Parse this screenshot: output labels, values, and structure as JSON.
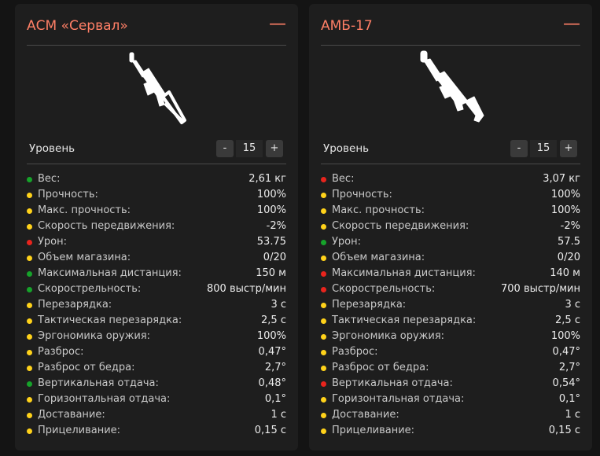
{
  "colors": {
    "green": "#16a32a",
    "yellow": "#ffd21a",
    "red": "#e8241d",
    "accent": "#ff7f66"
  },
  "cards": [
    {
      "title": "АСМ «Сервал»",
      "collapse_icon": "minus-icon",
      "image_icon": "rifle-silhouette-icon",
      "level": {
        "label": "Уровень",
        "minus": "-",
        "value": "15",
        "plus": "+"
      },
      "stats": [
        {
          "name": "Вес:",
          "value": "2,61 кг",
          "status": "green"
        },
        {
          "name": "Прочность:",
          "value": "100%",
          "status": "yellow"
        },
        {
          "name": "Макс. прочность:",
          "value": "100%",
          "status": "yellow"
        },
        {
          "name": "Скорость передвижения:",
          "value": "-2%",
          "status": "yellow"
        },
        {
          "name": "Урон:",
          "value": "53.75",
          "status": "red"
        },
        {
          "name": "Объем магазина:",
          "value": "0/20",
          "status": "yellow"
        },
        {
          "name": "Максимальная дистанция:",
          "value": "150 м",
          "status": "green"
        },
        {
          "name": "Скорострельность:",
          "value": "800 выстр/мин",
          "status": "green"
        },
        {
          "name": "Перезарядка:",
          "value": "3 с",
          "status": "yellow"
        },
        {
          "name": "Тактическая перезарядка:",
          "value": "2,5 с",
          "status": "yellow"
        },
        {
          "name": "Эргономика оружия:",
          "value": "100%",
          "status": "yellow"
        },
        {
          "name": "Разброс:",
          "value": "0,47°",
          "status": "yellow"
        },
        {
          "name": "Разброс от бедра:",
          "value": "2,7°",
          "status": "yellow"
        },
        {
          "name": "Вертикальная отдача:",
          "value": "0,48°",
          "status": "green"
        },
        {
          "name": "Горизонтальная отдача:",
          "value": "0,1°",
          "status": "yellow"
        },
        {
          "name": "Доставание:",
          "value": "1 с",
          "status": "yellow"
        },
        {
          "name": "Прицеливание:",
          "value": "0,15 с",
          "status": "yellow"
        }
      ]
    },
    {
      "title": "АМБ-17",
      "collapse_icon": "minus-icon",
      "image_icon": "smg-silhouette-icon",
      "level": {
        "label": "Уровень",
        "minus": "-",
        "value": "15",
        "plus": "+"
      },
      "stats": [
        {
          "name": "Вес:",
          "value": "3,07 кг",
          "status": "red"
        },
        {
          "name": "Прочность:",
          "value": "100%",
          "status": "yellow"
        },
        {
          "name": "Макс. прочность:",
          "value": "100%",
          "status": "yellow"
        },
        {
          "name": "Скорость передвижения:",
          "value": "-2%",
          "status": "yellow"
        },
        {
          "name": "Урон:",
          "value": "57.5",
          "status": "green"
        },
        {
          "name": "Объем магазина:",
          "value": "0/20",
          "status": "yellow"
        },
        {
          "name": "Максимальная дистанция:",
          "value": "140 м",
          "status": "red"
        },
        {
          "name": "Скорострельность:",
          "value": "700 выстр/мин",
          "status": "red"
        },
        {
          "name": "Перезарядка:",
          "value": "3 с",
          "status": "yellow"
        },
        {
          "name": "Тактическая перезарядка:",
          "value": "2,5 с",
          "status": "yellow"
        },
        {
          "name": "Эргономика оружия:",
          "value": "100%",
          "status": "yellow"
        },
        {
          "name": "Разброс:",
          "value": "0,47°",
          "status": "yellow"
        },
        {
          "name": "Разброс от бедра:",
          "value": "2,7°",
          "status": "yellow"
        },
        {
          "name": "Вертикальная отдача:",
          "value": "0,54°",
          "status": "red"
        },
        {
          "name": "Горизонтальная отдача:",
          "value": "0,1°",
          "status": "yellow"
        },
        {
          "name": "Доставание:",
          "value": "1 с",
          "status": "yellow"
        },
        {
          "name": "Прицеливание:",
          "value": "0,15 с",
          "status": "yellow"
        }
      ]
    }
  ]
}
